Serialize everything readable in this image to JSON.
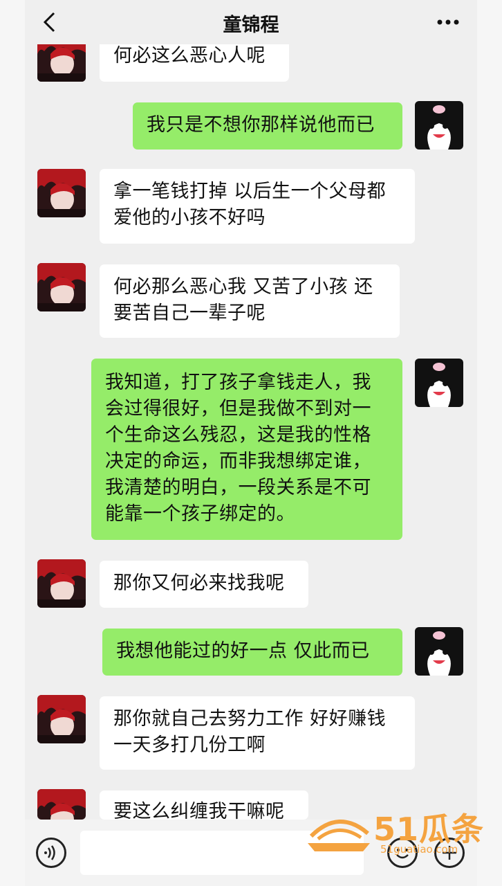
{
  "header": {
    "title": "童锦程",
    "back_icon": "chevron-left-icon",
    "more_icon": "more-dots-icon"
  },
  "messages": [
    {
      "side": "in",
      "text": "何必这么恶心人呢"
    },
    {
      "side": "out",
      "text": "我只是不想你那样说他而已"
    },
    {
      "side": "in",
      "text": "拿一笔钱打掉 以后生一个父母都\n爱他的小孩不好吗"
    },
    {
      "side": "in",
      "text": "何必那么恶心我 又苦了小孩 还\n要苦自己一辈子呢"
    },
    {
      "side": "out",
      "text": "我知道，打了孩子拿钱走人，我\n会过得很好，但是我做不到对一\n个生命这么残忍，这是我的性格\n决定的命运，而非我想绑定谁，\n我清楚的明白，一段关系是不可\n能靠一个孩子绑定的。"
    },
    {
      "side": "in",
      "text": "那你又何必来找我呢"
    },
    {
      "side": "out",
      "text": "我想他能过的好一点 仅此而已"
    },
    {
      "side": "in",
      "text": "那你就自己去努力工作 好好赚钱\n一天多打几份工啊"
    },
    {
      "side": "in",
      "text": "要这么纠缠我干嘛呢"
    }
  ],
  "bottom_bar": {
    "voice_icon": "voice-icon",
    "emoji_icon": "emoji-icon",
    "plus_icon": "plus-icon"
  },
  "watermark": {
    "brand": "51瓜条",
    "url": "51guatiao.com"
  },
  "colors": {
    "bubble_out": "#95ec69",
    "bubble_in": "#ffffff",
    "background": "#efefef",
    "watermark": "#f4a340"
  }
}
